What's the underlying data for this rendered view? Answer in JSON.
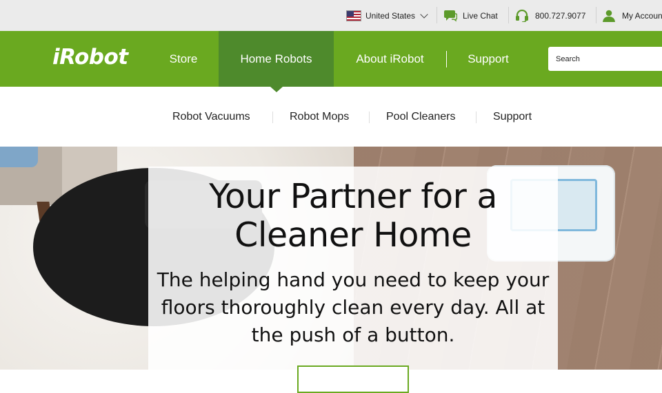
{
  "utility_bar": {
    "country": "United States",
    "live_chat": "Live Chat",
    "phone": "800.727.9077",
    "account": "My Account"
  },
  "brand": {
    "logo_text": "iRobot"
  },
  "main_nav": {
    "items": [
      {
        "label": "Store"
      },
      {
        "label": "Home Robots",
        "active": true
      },
      {
        "label": "About iRobot"
      },
      {
        "label": "Support"
      }
    ],
    "search_placeholder": "Search"
  },
  "sub_nav": {
    "items": [
      {
        "label": "Robot Vacuums"
      },
      {
        "label": "Robot Mops"
      },
      {
        "label": "Pool Cleaners"
      },
      {
        "label": "Support"
      }
    ]
  },
  "hero": {
    "headline": "Your Partner for a Cleaner Home",
    "subheadline": "The helping hand you need to keep your floors thoroughly clean every day. All at the push of a button."
  },
  "colors": {
    "brand_green": "#6aa920",
    "active_green": "#4e8a2c",
    "utility_bg": "#ebebeb"
  },
  "icons": [
    "us-flag-icon",
    "chevron-down-icon",
    "chat-bubble-icon",
    "headset-icon",
    "user-icon"
  ]
}
